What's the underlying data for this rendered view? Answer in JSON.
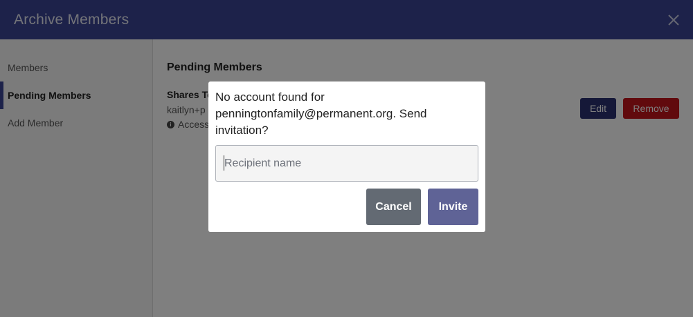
{
  "header": {
    "title": "Archive Members",
    "close_icon": "close-icon"
  },
  "sidebar": {
    "items": [
      {
        "label": "Members",
        "active": false
      },
      {
        "label": "Pending Members",
        "active": true
      },
      {
        "label": "Add Member",
        "active": false
      }
    ]
  },
  "main": {
    "section_title": "Pending Members",
    "member": {
      "name": "Shares Te",
      "email": "kaitlyn+p",
      "access": "Access:"
    },
    "edit_label": "Edit",
    "remove_label": "Remove"
  },
  "modal": {
    "message": "No account found for penningtonfamily@permanent.org. Send invitation?",
    "input_placeholder": "Recipient name",
    "input_value": "",
    "cancel_label": "Cancel",
    "invite_label": "Invite"
  },
  "colors": {
    "header_bg": "#3a4494",
    "edit_bg": "#2a3170",
    "remove_bg": "#c3141a",
    "cancel_bg": "#636a73",
    "invite_bg": "#5f6396"
  }
}
